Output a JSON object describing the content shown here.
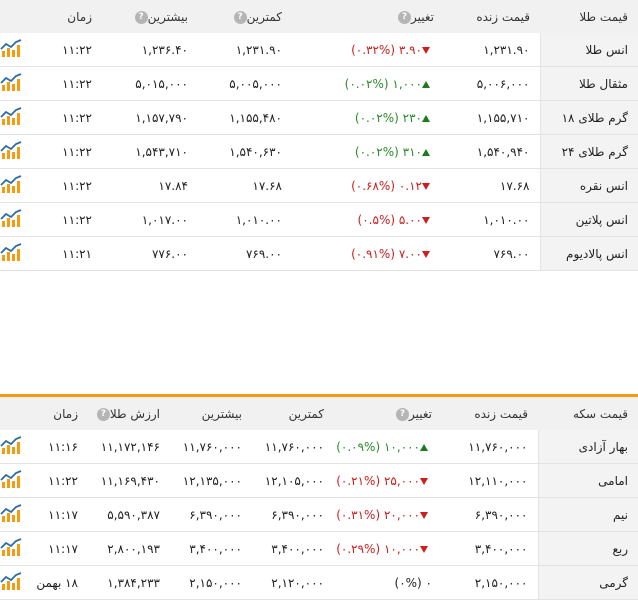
{
  "gold": {
    "headers": {
      "name": "قیمت طلا",
      "live": "قیمت زنده",
      "change": "تغییر",
      "low": "کمترین",
      "high": "بیشترین",
      "time": "زمان"
    },
    "rows": [
      {
        "name": "انس طلا",
        "live": "۱,۲۳۱.۹۰",
        "change": "۳.۹۰ (۰.۳۲%)",
        "dir": "down",
        "low": "۱,۲۳۱.۹۰",
        "high": "۱,۲۳۶.۴۰",
        "time": "۱۱:۲۲"
      },
      {
        "name": "مثقال طلا",
        "live": "۵,۰۰۶,۰۰۰",
        "change": "۱,۰۰۰ (۰.۰۲%)",
        "dir": "up",
        "low": "۵,۰۰۵,۰۰۰",
        "high": "۵,۰۱۵,۰۰۰",
        "time": "۱۱:۲۲"
      },
      {
        "name": "گرم طلای ۱۸",
        "live": "۱,۱۵۵,۷۱۰",
        "change": "۲۳۰ (۰.۰۲%)",
        "dir": "up",
        "low": "۱,۱۵۵,۴۸۰",
        "high": "۱,۱۵۷,۷۹۰",
        "time": "۱۱:۲۲"
      },
      {
        "name": "گرم طلای ۲۴",
        "live": "۱,۵۴۰,۹۴۰",
        "change": "۳۱۰ (۰.۰۲%)",
        "dir": "up",
        "low": "۱,۵۴۰,۶۳۰",
        "high": "۱,۵۴۳,۷۱۰",
        "time": "۱۱:۲۲"
      },
      {
        "name": "انس نقره",
        "live": "۱۷.۶۸",
        "change": "۰.۱۲ (۰.۶۸%)",
        "dir": "down",
        "low": "۱۷.۶۸",
        "high": "۱۷.۸۴",
        "time": "۱۱:۲۲"
      },
      {
        "name": "انس پلاتین",
        "live": "۱,۰۱۰.۰۰",
        "change": "۵.۰۰ (۰.۵%)",
        "dir": "down",
        "low": "۱,۰۱۰.۰۰",
        "high": "۱,۰۱۷.۰۰",
        "time": "۱۱:۲۲"
      },
      {
        "name": "انس پالادیوم",
        "live": "۷۶۹.۰۰",
        "change": "۷.۰۰ (۰.۹۱%)",
        "dir": "down",
        "low": "۷۶۹.۰۰",
        "high": "۷۷۶.۰۰",
        "time": "۱۱:۲۱"
      }
    ]
  },
  "coin": {
    "headers": {
      "name": "قیمت سکه",
      "live": "قیمت زنده",
      "change": "تغییر",
      "low": "کمترین",
      "high": "بیشترین",
      "value": "ارزش طلا",
      "time": "زمان"
    },
    "rows": [
      {
        "name": "بهار آزادی",
        "live": "۱۱,۷۶۰,۰۰۰",
        "change": "۱۰,۰۰۰ (۰.۰۹%)",
        "dir": "up",
        "low": "۱۱,۷۶۰,۰۰۰",
        "high": "۱۱,۷۶۰,۰۰۰",
        "value": "۱۱,۱۷۲,۱۴۶",
        "time": "۱۱:۱۶"
      },
      {
        "name": "امامی",
        "live": "۱۲,۱۱۰,۰۰۰",
        "change": "۲۵,۰۰۰ (۰.۲۱%)",
        "dir": "down",
        "low": "۱۲,۱۰۵,۰۰۰",
        "high": "۱۲,۱۳۵,۰۰۰",
        "value": "۱۱,۱۶۹,۴۳۰",
        "time": "۱۱:۲۲"
      },
      {
        "name": "نیم",
        "live": "۶,۳۹۰,۰۰۰",
        "change": "۲۰,۰۰۰ (۰.۳۱%)",
        "dir": "down",
        "low": "۶,۳۹۰,۰۰۰",
        "high": "۶,۳۹۰,۰۰۰",
        "value": "۵,۵۹۰,۳۸۷",
        "time": "۱۱:۱۷"
      },
      {
        "name": "ربع",
        "live": "۳,۴۰۰,۰۰۰",
        "change": "۱۰,۰۰۰ (۰.۲۹%)",
        "dir": "down",
        "low": "۳,۴۰۰,۰۰۰",
        "high": "۳,۴۰۰,۰۰۰",
        "value": "۲,۸۰۰,۱۹۳",
        "time": "۱۱:۱۷"
      },
      {
        "name": "گرمی",
        "live": "۲,۱۵۰,۰۰۰",
        "change": "۰ (۰%)",
        "dir": "neutral",
        "low": "۲,۱۲۰,۰۰۰",
        "high": "۲,۱۵۰,۰۰۰",
        "value": "۱,۳۸۴,۲۳۳",
        "time": "۱۸ بهمن"
      }
    ]
  },
  "icons": {
    "help": "help-icon",
    "chart": "chart-icon"
  },
  "colors": {
    "up": "#2a8a2a",
    "down": "#cc2020",
    "accent": "#f39c12",
    "chart_orange": "#f39c12",
    "chart_blue": "#2e6da4"
  }
}
